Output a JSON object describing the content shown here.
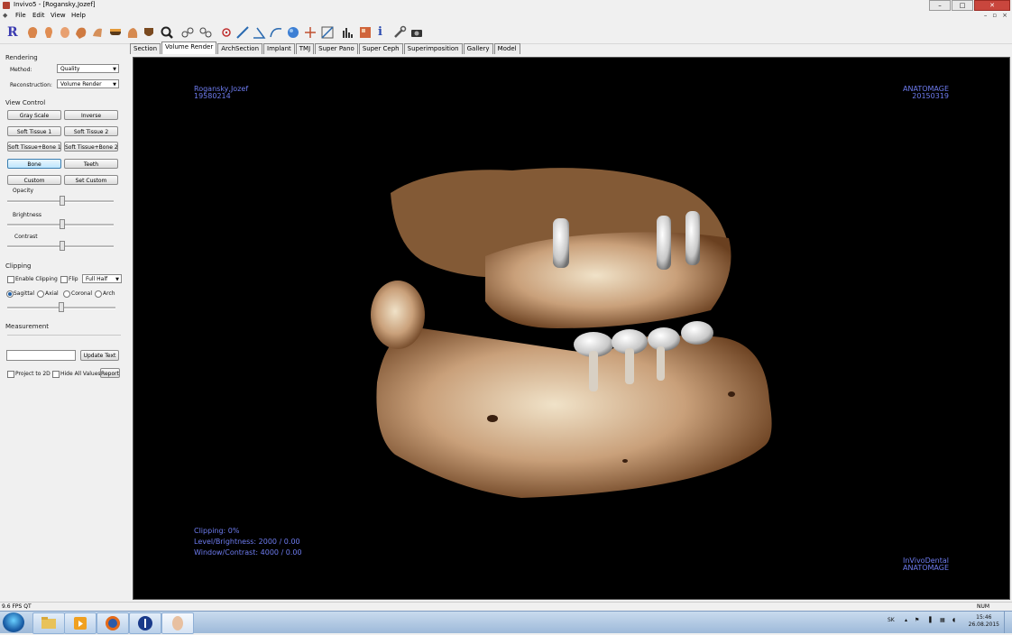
{
  "window": {
    "title": "Invivo5 - [Rogansky,Jozef]"
  },
  "menu": {
    "file": "File",
    "edit": "Edit",
    "view": "View",
    "help": "Help"
  },
  "toolbar": {
    "icons": [
      "r-logo-icon",
      "skull-side-icon",
      "skull-front-icon",
      "face-icon",
      "skull-3d-icon",
      "nerve-icon",
      "mask-icon",
      "head-icon",
      "jaw-icon",
      "magnify-icon",
      "implant-icon",
      "implant-2-icon",
      "target-icon",
      "measure-ruler-icon",
      "angle-icon",
      "curve-icon",
      "sphere-icon",
      "crosshair-icon",
      "cross-section-icon",
      "histogram-icon",
      "layout-icon",
      "info-icon",
      "wrench-icon",
      "camera-icon"
    ]
  },
  "tabs": [
    "Section",
    "Volume Render",
    "ArchSection",
    "Implant",
    "TMJ",
    "Super Pano",
    "Super Ceph",
    "Superimposition",
    "Gallery",
    "Model"
  ],
  "active_tab": "Volume Render",
  "left_panel": {
    "rendering": {
      "header": "Rendering",
      "method_label": "Method:",
      "method_value": "Quality",
      "reconstruction_label": "Reconstruction:",
      "reconstruction_value": "Volume Render"
    },
    "view_control": {
      "header": "View Control",
      "buttons": [
        "Gray Scale",
        "Inverse",
        "Soft Tissue 1",
        "Soft Tissue 2",
        "Soft Tissue+Bone 1",
        "Soft Tissue+Bone 2",
        "Bone",
        "Teeth",
        "Custom",
        "Set Custom"
      ],
      "selected": "Bone",
      "opacity_label": "Opacity",
      "brightness_label": "Brightness",
      "contrast_label": "Contrast",
      "opacity_level": 0.52,
      "brightness_level": 0.52,
      "contrast_level": 0.52
    },
    "clipping": {
      "header": "Clipping",
      "enable_label": "Enable Clipping",
      "flip_label": "Flip",
      "half_value": "Full Half",
      "radios": [
        "Sagittal",
        "Axial",
        "Coronal",
        "Arch"
      ],
      "selected_radio": "Sagittal",
      "slider_level": 0.5
    },
    "measurement": {
      "header": "Measurement",
      "text_value": "",
      "update_button": "Update Text",
      "project_label": "Project to 2D",
      "hide_label": "Hide All Values",
      "report_button": "Report"
    }
  },
  "viewport": {
    "patient_name": "Rogansky,Jozef",
    "patient_dob": "19580214",
    "brand": "ANATOMAGE",
    "scan_date": "20150319",
    "clipping_line": "Clipping:   0%",
    "level_line": "Level/Brightness:   2000 / 0.00",
    "window_line": "Window/Contrast:  4000 / 0.00",
    "footer_brand_1": "InVivoDental",
    "footer_brand_2": "ANATOMAGE",
    "overlay_color": "#6e7cf0"
  },
  "status": {
    "fps": "9.6 FPS QT",
    "num": "NUM"
  },
  "taskbar": {
    "lang": "SK",
    "time": "15:46",
    "date": "26.08.2015"
  }
}
